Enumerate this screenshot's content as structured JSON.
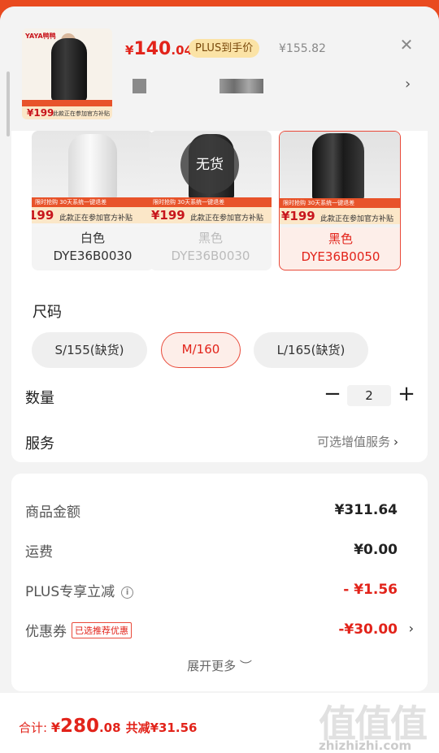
{
  "header": {
    "thumb_brand": "YAYA鸭鸭",
    "thumb_price": "¥199",
    "thumb_text": "此款正在参加官方补贴",
    "price_currency": "¥",
    "price_integer": "140",
    "price_decimal": ".04",
    "plus_tag": "PLUS到手价",
    "original_price": "¥155.82",
    "close_glyph": "✕",
    "chevron_glyph": "›"
  },
  "variants": [
    {
      "name": "白色",
      "code": "DYE36B0030",
      "price": "199",
      "promo": "限时抢购  30天系统一键退差",
      "subsidy": "此款正在参加官方补贴",
      "state": "normal"
    },
    {
      "name": "黑色",
      "code": "DYE36B0030",
      "price": "¥199",
      "promo": "限时抢购  30天系统一键退差",
      "subsidy": "此款正在参加官方补贴",
      "state": "disabled",
      "badge": "无货"
    },
    {
      "name": "黑色",
      "code": "DYE36B0050",
      "price": "¥199",
      "promo": "限时抢购  30天系统一键退差",
      "subsidy": "此款正在参加官方补贴",
      "state": "selected"
    }
  ],
  "size": {
    "title": "尺码",
    "options": [
      {
        "label": "S/155(缺货)",
        "state": "normal"
      },
      {
        "label": "M/160",
        "state": "selected"
      },
      {
        "label": "L/165(缺货)",
        "state": "normal"
      }
    ]
  },
  "quantity": {
    "label": "数量",
    "minus": "−",
    "value": "2",
    "plus": "+"
  },
  "service": {
    "label": "服务",
    "link": "可选增值服务",
    "chevron": "›"
  },
  "summary": {
    "goods_amount": {
      "label": "商品金额",
      "value": "¥311.64"
    },
    "shipping": {
      "label": "运费",
      "value": "¥0.00"
    },
    "plus_discount": {
      "label": "PLUS专享立减",
      "info": "i",
      "value": "- ¥1.56"
    },
    "coupon": {
      "label": "优惠券",
      "tag": "已选推荐优惠",
      "value": "-¥30.00",
      "chevron": "›"
    },
    "expand": "展开更多 ︶"
  },
  "footer": {
    "total_label": "合计: ",
    "currency": "¥",
    "total_integer": "280",
    "total_decimal": ".08",
    "saved": "共减¥31.56",
    "watermark_main": "值值值",
    "watermark_sub": "zhizhizhi.com"
  },
  "colors": {
    "accent": "#e2231a",
    "page_bg": "#e94a1f",
    "gold": "#fcc72e"
  }
}
